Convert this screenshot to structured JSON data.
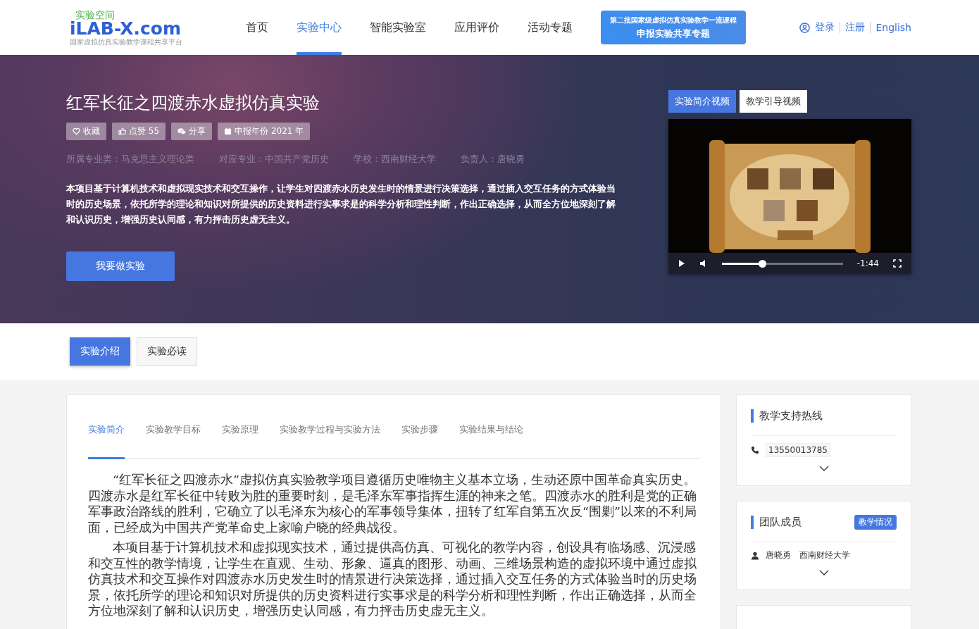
{
  "header": {
    "logo": {
      "top": "实验空间",
      "main": "iLAB-X.com",
      "sub": "国家虚拟仿真实验教学课程共享平台"
    },
    "nav": [
      {
        "label": "首页",
        "selected": false
      },
      {
        "label": "实验中心",
        "selected": true
      },
      {
        "label": "智能实验室",
        "selected": false
      },
      {
        "label": "应用评价",
        "selected": false
      },
      {
        "label": "活动专题",
        "selected": false
      }
    ],
    "promo": {
      "line1": "第二批国家级虚拟仿真实验教学一流课程",
      "line2": "申报实验共享专题"
    },
    "account": [
      {
        "label": "登录",
        "kind": "user"
      },
      {
        "label": "注册",
        "kind": "plain"
      },
      {
        "label": "English",
        "kind": "plain"
      }
    ]
  },
  "hero": {
    "title": "红军长征之四渡赤水虚拟仿真实验",
    "badges": [
      {
        "label": "收藏",
        "kind": "heart"
      },
      {
        "label": "点赞 55",
        "kind": "thumb"
      },
      {
        "label": "分享",
        "kind": "chat"
      },
      {
        "label": "申报年份 2021 年",
        "kind": "calendar"
      }
    ],
    "meta": [
      "所属专业类：马克思主义理论类",
      "对应专业：中国共产党历史",
      "学校：西南财经大学",
      "负责人：唐晓勇"
    ],
    "summary": "本项目基于计算机技术和虚拟现实技术和交互操作，让学生对四渡赤水历史发生时的情景进行决策选择，通过插入交互任务的方式体验当时的历史场景，依托所学的理论和知识对所提供的历史资料进行实事求是的科学分析和理性判断，作出正确选择，从而全方位地深刻了解和认识历史，增强历史认同感，有力抨击历史虚无主义。",
    "cta": "我要做实验",
    "video_tabs": [
      {
        "label": "实验简介视频",
        "selected": true
      },
      {
        "label": "教学引导视频",
        "selected": false
      }
    ],
    "video": {
      "kind": "picture",
      "time": "-1:44",
      "level": 0.34
    }
  },
  "section_tabs": [
    {
      "label": "实验介绍",
      "selected": true
    },
    {
      "label": "实验必读",
      "selected": false
    }
  ],
  "article": {
    "tabs": [
      {
        "label": "实验简介",
        "selected": true
      },
      {
        "label": "实验教学目标",
        "selected": false
      },
      {
        "label": "实验原理",
        "selected": false
      },
      {
        "label": "实验教学过程与实验方法",
        "selected": false
      },
      {
        "label": "实验步骤",
        "selected": false
      },
      {
        "label": "实验结果与结论",
        "selected": false
      }
    ],
    "paragraphs": [
      "“红军长征之四渡赤水”虚拟仿真实验教学项目遵循历史唯物主义基本立场，生动还原中国革命真实历史。四渡赤水是红军长征中转败为胜的重要时刻，是毛泽东军事指挥生涯的神来之笔。四渡赤水的胜利是党的正确军事政治路线的胜利，它确立了以毛泽东为核心的军事领导集体，扭转了红军自第五次反“围剿”以来的不利局面，已经成为中国共产党革命史上家喻户晓的经典战役。",
      "本项目基于计算机技术和虚拟现实技术，通过提供高仿真、可视化的教学内容，创设具有临场感、沉浸感和交互性的教学情境，让学生在直观、生动、形象、逼真的图形、动画、三维场景构造的虚拟环境中通过虚拟仿真技术和交互操作对四渡赤水历史发生时的情景进行决策选择，通过插入交互任务的方式体验当时的历史场景，依托所学的理论和知识对所提供的历史资料进行实事求是的科学分析和理性判断，作出正确选择，从而全方位地深刻了解和认识历史，增强历史认同感，有力抨击历史虚无主义。"
    ]
  },
  "sidebar": [
    {
      "title": "教学支持热线",
      "kind": "phone",
      "value": "13550013785"
    },
    {
      "title": "团队成员",
      "kind": "member",
      "badge": "教学情况",
      "name": "唐晓勇",
      "school": "西南财经大学"
    }
  ]
}
